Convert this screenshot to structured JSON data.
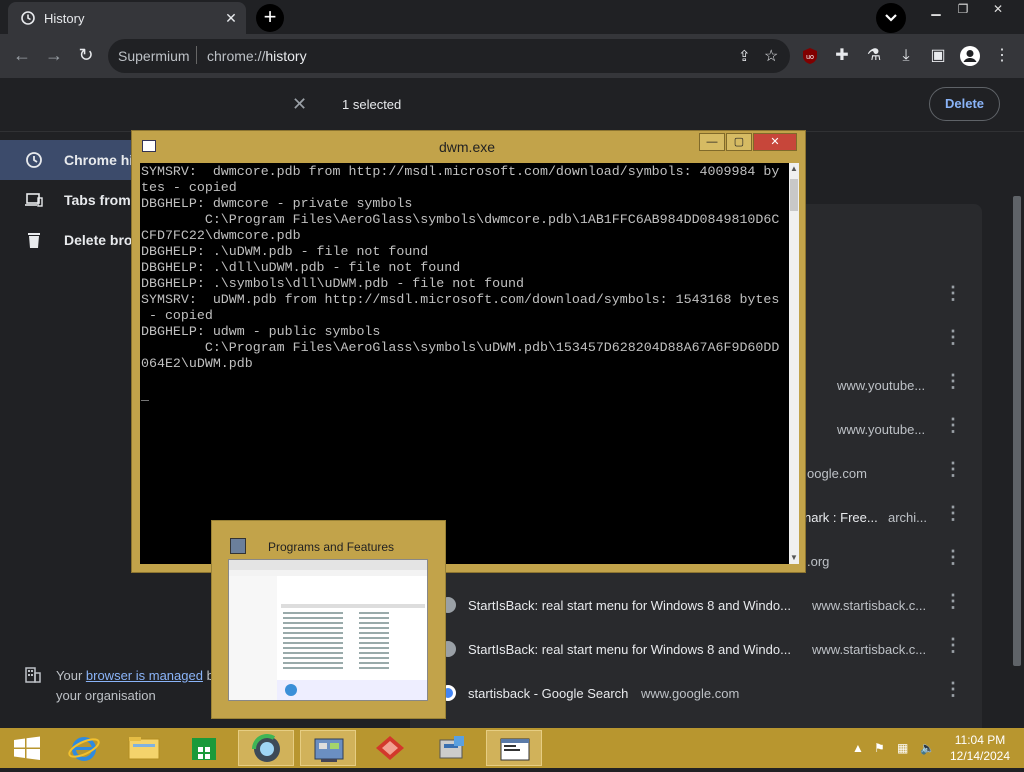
{
  "browser": {
    "tab_title": "History",
    "tab_close": "✕",
    "new_tab": "+",
    "omnibox_brand": "Supermium",
    "omnibox_scheme": "chrome://",
    "omnibox_host": "history",
    "nav_back": "←",
    "nav_forward": "→",
    "nav_reload": "↻"
  },
  "selection_bar": {
    "clear": "✕",
    "count": "1 selected",
    "delete": "Delete"
  },
  "sidebar": {
    "items": [
      {
        "label": "Chrome hi"
      },
      {
        "label": "Tabs from"
      },
      {
        "label": "Delete bro"
      }
    ],
    "managed_prefix": "Your ",
    "managed_link": "browser is managed",
    "managed_mid": " b",
    "managed_suffix": "your organisation"
  },
  "history": {
    "rows": [
      {
        "title": "",
        "domain": ""
      },
      {
        "title": "",
        "domain": ""
      },
      {
        "title": "",
        "domain": "www.youtube..."
      },
      {
        "title": "",
        "domain": "www.youtube..."
      },
      {
        "title": "",
        "domain": "oogle.com"
      },
      {
        "title": "nark : Free...",
        "domain": "archi..."
      },
      {
        "title": "",
        "domain": ".org"
      },
      {
        "title": "StartIsBack: real start menu for Windows 8 and Windo...",
        "domain": "www.startisback.c..."
      },
      {
        "title": "StartIsBack: real start menu for Windows 8 and Windo...",
        "domain": "www.startisback.c..."
      },
      {
        "title": "startisback - Google Search",
        "domain": "www.google.com"
      }
    ],
    "more": "⋮"
  },
  "console": {
    "title": "dwm.exe",
    "text": "SYMSRV:  dwmcore.pdb from http://msdl.microsoft.com/download/symbols: 4009984 by\ntes - copied\nDBGHELP: dwmcore - private symbols\n        C:\\Program Files\\AeroGlass\\symbols\\dwmcore.pdb\\1AB1FFC6AB984DD0849810D6C\nCFD7FC22\\dwmcore.pdb\nDBGHELP: .\\uDWM.pdb - file not found\nDBGHELP: .\\dll\\uDWM.pdb - file not found\nDBGHELP: .\\symbols\\dll\\uDWM.pdb - file not found\nSYMSRV:  uDWM.pdb from http://msdl.microsoft.com/download/symbols: 1543168 bytes\n - copied\nDBGHELP: udwm - public symbols\n        C:\\Program Files\\AeroGlass\\symbols\\uDWM.pdb\\153457D628204D88A67A6F9D60DD\n064E2\\uDWM.pdb\n\n_",
    "min": "—",
    "max": "▢",
    "close": "✕"
  },
  "preview": {
    "title": "Programs and Features"
  },
  "taskbar": {
    "time": "11:04 PM",
    "date": "12/14/2024"
  }
}
